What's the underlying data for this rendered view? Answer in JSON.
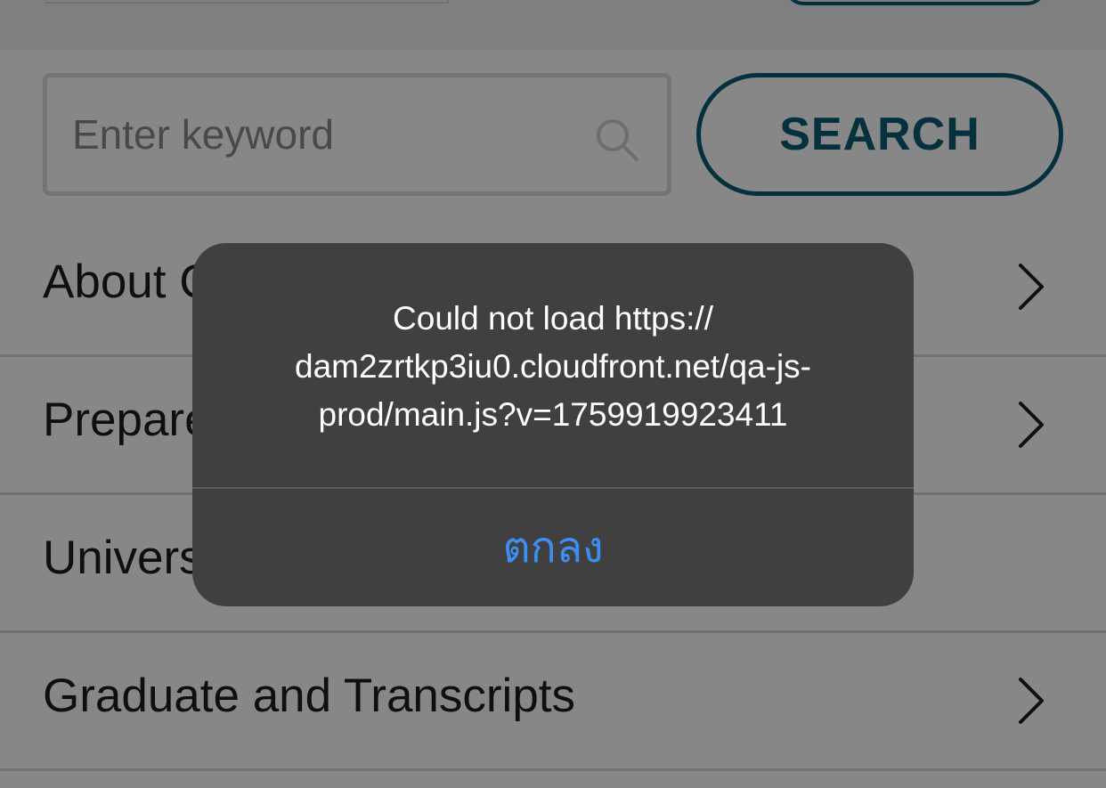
{
  "search": {
    "placeholder": "Enter keyword",
    "button_label": "SEARCH"
  },
  "menu": {
    "items": [
      {
        "label": "About C"
      },
      {
        "label": "Prepare"
      },
      {
        "label": "Univers"
      },
      {
        "label": "Graduate and Transcripts"
      }
    ]
  },
  "alert": {
    "message_lines": [
      "Could not load https://",
      "dam2zrtkp3iu0.cloudfront.net/qa-js-",
      "prod/main.js?v=1759919923411"
    ],
    "ok_label": "ตกลง"
  },
  "colors": {
    "accent": "#0a5d78",
    "alert_background": "#404040",
    "alert_button": "#3d8ef2"
  }
}
